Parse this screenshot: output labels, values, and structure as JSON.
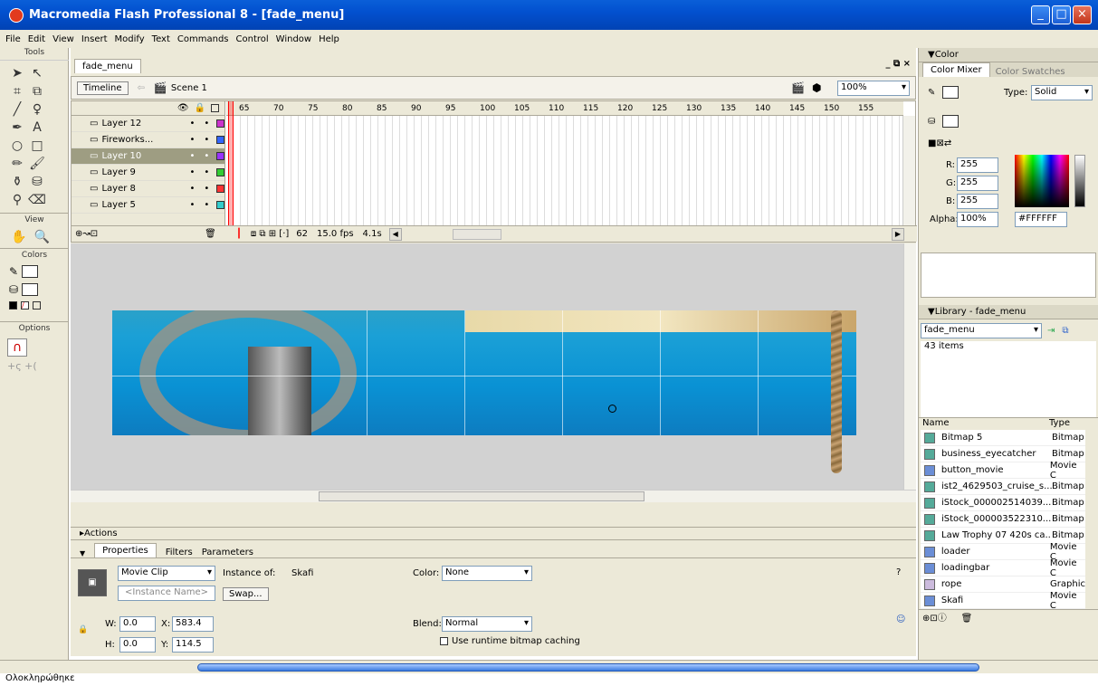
{
  "window": {
    "title": "Macromedia Flash Professional 8 - [fade_menu]"
  },
  "menu": [
    "File",
    "Edit",
    "View",
    "Insert",
    "Modify",
    "Text",
    "Commands",
    "Control",
    "Window",
    "Help"
  ],
  "toolbox": {
    "header": "Tools",
    "view_label": "View",
    "colors_label": "Colors",
    "options_label": "Options"
  },
  "document": {
    "tab": "fade_menu",
    "timeline_button": "Timeline",
    "scene": "Scene 1",
    "zoom": "100%"
  },
  "timeline": {
    "frame_numbers": [
      "65",
      "70",
      "75",
      "80",
      "85",
      "90",
      "95",
      "100",
      "105",
      "110",
      "115",
      "120",
      "125",
      "130",
      "135",
      "140",
      "145",
      "150",
      "155"
    ],
    "layers": [
      {
        "name": "Layer 12",
        "color": "#cc33cc"
      },
      {
        "name": "Fireworks...",
        "color": "#3366ff"
      },
      {
        "name": "Layer 10",
        "color": "#9933ff"
      },
      {
        "name": "Layer 9",
        "color": "#33cc33"
      },
      {
        "name": "Layer 8",
        "color": "#ff3333"
      },
      {
        "name": "Layer 5",
        "color": "#33cccc"
      }
    ],
    "current_frame": "62",
    "fps": "15.0 fps",
    "time": "4.1s"
  },
  "actions": {
    "label": "Actions"
  },
  "properties": {
    "tabs": [
      "Properties",
      "Filters",
      "Parameters"
    ],
    "type": "Movie Clip",
    "instance_name_placeholder": "<Instance Name>",
    "instance_of_label": "Instance of:",
    "instance_of": "Skafi",
    "swap": "Swap...",
    "color_label": "Color:",
    "color_value": "None",
    "blend_label": "Blend:",
    "blend_value": "Normal",
    "bitmap_cache": "Use runtime bitmap caching",
    "w": "0.0",
    "h": "0.0",
    "x": "583.4",
    "y": "114.5"
  },
  "color_panel": {
    "title": "Color",
    "tabs": [
      "Color Mixer",
      "Color Swatches"
    ],
    "type_label": "Type:",
    "type_value": "Solid",
    "r": "255",
    "g": "255",
    "b": "255",
    "alpha": "100%",
    "hex": "#FFFFFF"
  },
  "library": {
    "title": "Library - fade_menu",
    "selected": "fade_menu",
    "count": "43 items",
    "col_name": "Name",
    "col_type": "Type",
    "items": [
      {
        "name": "Bitmap 5",
        "type": "Bitmap"
      },
      {
        "name": "business_eyecatcher",
        "type": "Bitmap"
      },
      {
        "name": "button_movie",
        "type": "Movie C"
      },
      {
        "name": "ist2_4629503_cruise_s...",
        "type": "Bitmap"
      },
      {
        "name": "iStock_000002514039...",
        "type": "Bitmap"
      },
      {
        "name": "iStock_000003522310...",
        "type": "Bitmap"
      },
      {
        "name": "Law Trophy 07 420s ca...",
        "type": "Bitmap"
      },
      {
        "name": "loader",
        "type": "Movie C"
      },
      {
        "name": "loadingbar",
        "type": "Movie C"
      },
      {
        "name": "rope",
        "type": "Graphic"
      },
      {
        "name": "Skafi",
        "type": "Movie C"
      }
    ]
  },
  "status": {
    "text": "Ολοκληρώθηκε"
  }
}
